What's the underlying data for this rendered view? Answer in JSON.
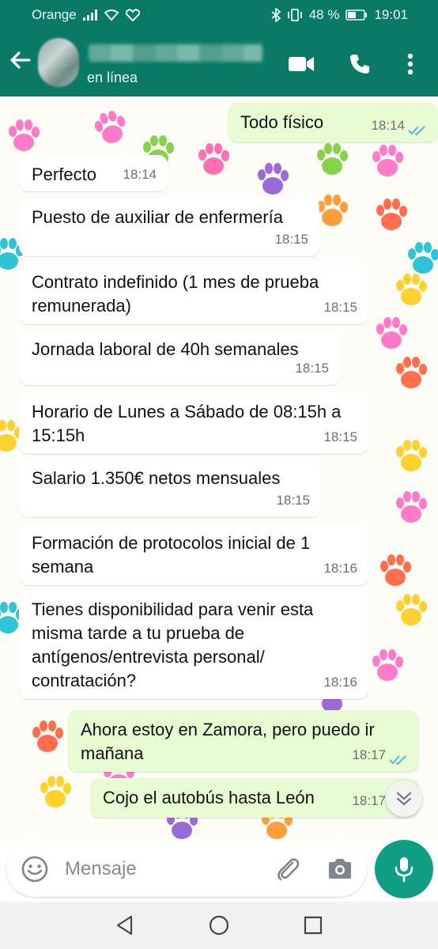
{
  "status_bar": {
    "carrier": "Orange",
    "battery": "48 %",
    "time": "19:01"
  },
  "header": {
    "contact_status": "en línea"
  },
  "messages": [
    {
      "dir": "out",
      "text": "Todo físico",
      "time": "18:14",
      "read": true
    },
    {
      "dir": "in",
      "text": "Perfecto",
      "time": "18:14"
    },
    {
      "dir": "in",
      "text": "Puesto de auxiliar de enfermería",
      "time": "18:15"
    },
    {
      "dir": "in",
      "text": "Contrato indefinido (1 mes de prueba remunerada)",
      "time": "18:15"
    },
    {
      "dir": "in",
      "text": "Jornada laboral de 40h semanales",
      "time": "18:15"
    },
    {
      "dir": "in",
      "text": "Horario de Lunes a Sábado de 08:15h a 15:15h",
      "time": "18:15"
    },
    {
      "dir": "in",
      "text": "Salario 1.350€ netos mensuales",
      "time": "18:15"
    },
    {
      "dir": "in",
      "text": "Formación de protocolos inicial de 1 semana",
      "time": "18:16"
    },
    {
      "dir": "in",
      "text": "Tienes disponibilidad para venir esta misma tarde a tu prueba de antígenos/entrevista personal/ contratación?",
      "time": "18:16"
    },
    {
      "dir": "out",
      "text": "Ahora estoy en Zamora, pero puedo ir mañana",
      "time": "18:17",
      "read": true
    },
    {
      "dir": "out",
      "text": "Cojo el autobús hasta León",
      "time": "18:17",
      "read": true
    }
  ],
  "composer": {
    "placeholder": "Mensaje"
  },
  "colors": {
    "header": "#0a7a66",
    "outgoing_bubble": "#e7fbd3",
    "incoming_bubble": "#ffffff",
    "read_ticks": "#4fb6ec",
    "mic_button": "#0f9d84"
  },
  "icons": {
    "header": [
      "back-arrow-icon",
      "video-call-icon",
      "phone-icon",
      "more-vert-icon"
    ],
    "composer": [
      "emoji-icon",
      "attach-icon",
      "camera-icon",
      "mic-icon"
    ],
    "navigation": [
      "nav-back-icon",
      "nav-home-icon",
      "nav-recents-icon"
    ],
    "chat": [
      "scroll-down-icon",
      "double-check-icon"
    ]
  }
}
